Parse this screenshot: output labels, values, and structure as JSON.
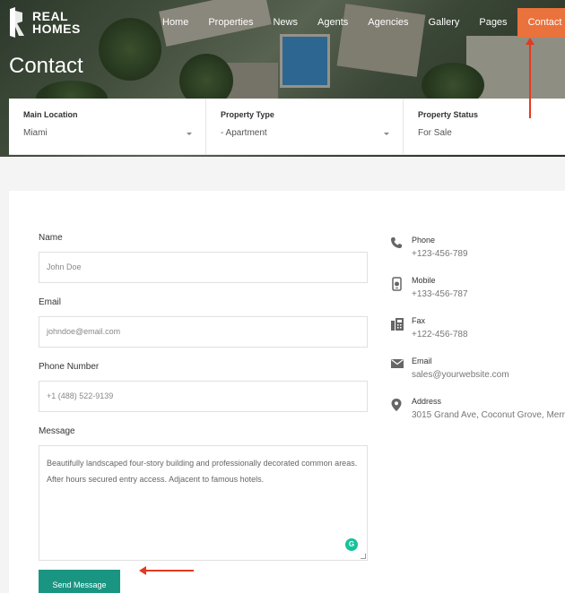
{
  "brand": {
    "line1": "REAL",
    "line2": "HOMES"
  },
  "nav": {
    "items": [
      "Home",
      "Properties",
      "News",
      "Agents",
      "Agencies",
      "Gallery",
      "Pages"
    ],
    "active": "Contact"
  },
  "page_title": "Contact",
  "filters": [
    {
      "label": "Main Location",
      "value": "Miami"
    },
    {
      "label": "Property Type",
      "value": "- Apartment"
    },
    {
      "label": "Property Status",
      "value": "For Sale"
    }
  ],
  "form": {
    "name_label": "Name",
    "name_placeholder": "John Doe",
    "email_label": "Email",
    "email_placeholder": "johndoe@email.com",
    "phone_label": "Phone Number",
    "phone_placeholder": "+1 (488) 522-9139",
    "message_label": "Message",
    "message_value": "Beautifully landscaped four-story building and professionally decorated common areas. After hours secured entry access. Adjacent to famous hotels.",
    "submit_label": "Send Message"
  },
  "contact_info": [
    {
      "icon": "phone-icon",
      "label": "Phone",
      "value": "+123-456-789"
    },
    {
      "icon": "mobile-icon",
      "label": "Mobile",
      "value": "+133-456-787"
    },
    {
      "icon": "fax-icon",
      "label": "Fax",
      "value": "+122-456-788"
    },
    {
      "icon": "email-icon",
      "label": "Email",
      "value": "sales@yourwebsite.com"
    },
    {
      "icon": "location-pin-icon",
      "label": "Address",
      "value": "3015 Grand Ave, Coconut Grove, Merr"
    }
  ],
  "colors": {
    "accent": "#ea723d",
    "button": "#1a9582",
    "annotation_arrow": "#e33a1f"
  }
}
